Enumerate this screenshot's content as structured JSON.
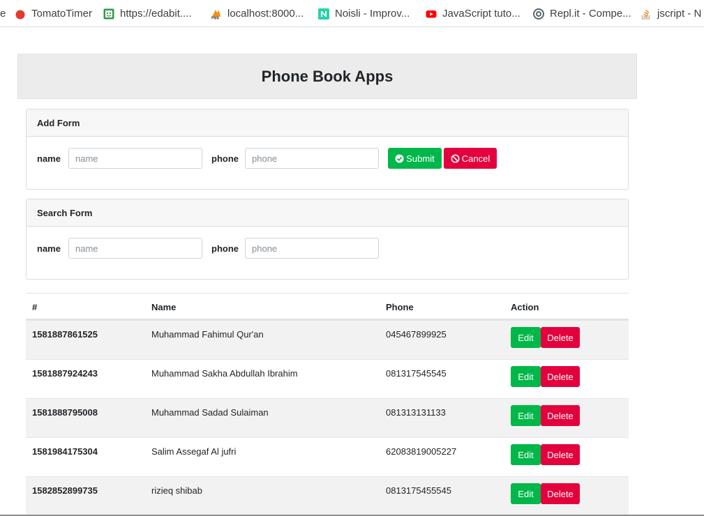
{
  "bookmarks": [
    {
      "label": "e",
      "icon": "partial-icon"
    },
    {
      "label": "TomatoTimer",
      "icon": "tomato-icon"
    },
    {
      "label": "https://edabit....",
      "icon": "edabit-icon"
    },
    {
      "label": "localhost:8000...",
      "icon": "pma-icon"
    },
    {
      "label": "Noisli - Improv...",
      "icon": "noisli-icon"
    },
    {
      "label": "JavaScript tuto...",
      "icon": "youtube-icon"
    },
    {
      "label": "Repl.it - Compe...",
      "icon": "replit-icon"
    },
    {
      "label": "jscript - N",
      "icon": "stackoverflow-icon"
    }
  ],
  "app": {
    "title": "Phone Book Apps"
  },
  "add_form": {
    "title": "Add Form",
    "name_label": "name",
    "name_placeholder": "name",
    "phone_label": "phone",
    "phone_placeholder": "phone",
    "submit_label": "Submit",
    "cancel_label": "Cancel"
  },
  "search_form": {
    "title": "Search Form",
    "name_label": "name",
    "name_placeholder": "name",
    "phone_label": "phone",
    "phone_placeholder": "phone"
  },
  "table": {
    "headers": [
      "#",
      "Name",
      "Phone",
      "Action"
    ],
    "rows": [
      {
        "id": "1581887861525",
        "name": "Muhammad Fahimul Qur'an",
        "phone": "045467899925",
        "edit": "Edit",
        "delete": "Delete"
      },
      {
        "id": "1581887924243",
        "name": "Muhammad Sakha Abdullah Ibrahim",
        "phone": "081317545545",
        "edit": "Edit",
        "delete": "Delete"
      },
      {
        "id": "1581888795008",
        "name": "Muhammad Sadad Sulaiman",
        "phone": "081313131133",
        "edit": "Edit",
        "delete": "Delete"
      },
      {
        "id": "1581984175304",
        "name": "Salim Assegaf Al jufri",
        "phone": "62083819005227",
        "edit": "Edit",
        "delete": "Delete"
      },
      {
        "id": "1582852899735",
        "name": "rizieq shibab",
        "phone": "0813175455545",
        "edit": "Edit",
        "delete": "Delete"
      }
    ]
  },
  "colors": {
    "success": "#00b74a",
    "danger": "#e4003c",
    "header_bg": "#ececec"
  }
}
